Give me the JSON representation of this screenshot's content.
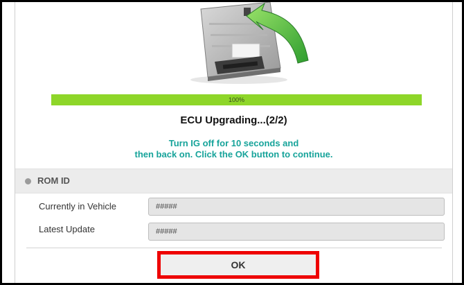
{
  "progress": {
    "value_percent": 100,
    "label": "100%"
  },
  "status": {
    "title": "ECU Upgrading...(2/2)"
  },
  "message": {
    "line1": "Turn IG off for 10 seconds and",
    "line2": "then back on. Click the OK button to continue."
  },
  "rom_id": {
    "header": "ROM ID",
    "rows": [
      {
        "label": "Currently in Vehicle",
        "value": "#####"
      },
      {
        "label": "Latest Update",
        "value": "#####"
      }
    ]
  },
  "actions": {
    "ok_label": "OK"
  },
  "colors": {
    "progress_fill": "#8ed629",
    "message_text": "#16a39a",
    "highlight_border": "#ee0000"
  },
  "icons": {
    "ecu": "ecu-module-icon",
    "arrow": "green-curved-arrow-icon"
  }
}
